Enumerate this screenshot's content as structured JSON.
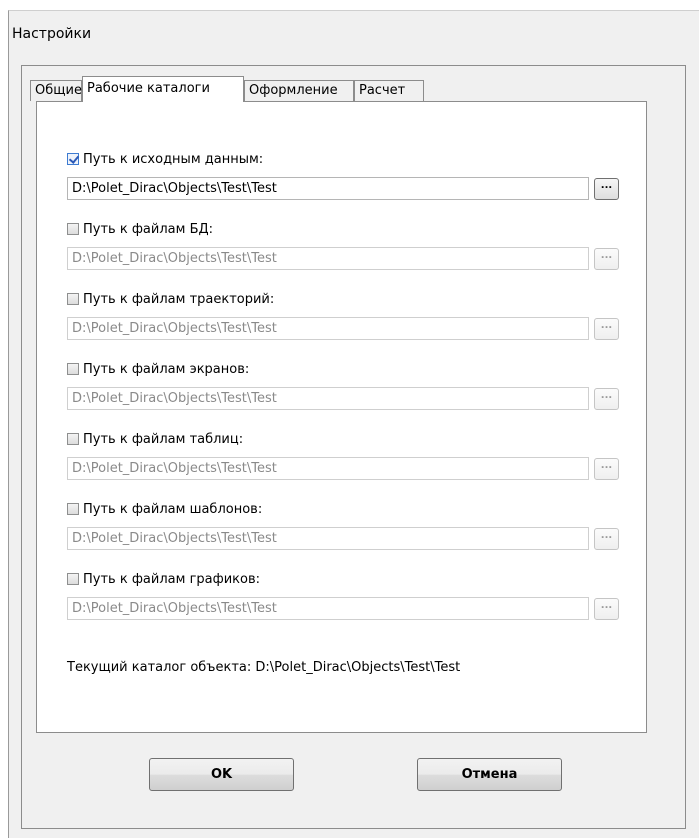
{
  "window": {
    "title": "Настройки"
  },
  "tabs": [
    {
      "label": "Общие",
      "active": false
    },
    {
      "label": "Рабочие каталоги",
      "active": true
    },
    {
      "label": "Оформление",
      "active": false
    },
    {
      "label": "Расчет",
      "active": false
    }
  ],
  "paths": [
    {
      "label": "Путь к исходным данным:",
      "checked": true,
      "value": "D:\\Polet_Dirac\\Objects\\Test\\Test",
      "enabled": true,
      "browse_label": "..."
    },
    {
      "label": "Путь к файлам БД:",
      "checked": false,
      "value": "D:\\Polet_Dirac\\Objects\\Test\\Test",
      "enabled": false,
      "browse_label": "..."
    },
    {
      "label": "Путь к файлам траекторий:",
      "checked": false,
      "value": "D:\\Polet_Dirac\\Objects\\Test\\Test",
      "enabled": false,
      "browse_label": "..."
    },
    {
      "label": "Путь к файлам экранов:",
      "checked": false,
      "value": "D:\\Polet_Dirac\\Objects\\Test\\Test",
      "enabled": false,
      "browse_label": "..."
    },
    {
      "label": "Путь к файлам таблиц:",
      "checked": false,
      "value": "D:\\Polet_Dirac\\Objects\\Test\\Test",
      "enabled": false,
      "browse_label": "..."
    },
    {
      "label": "Путь к файлам шаблонов:",
      "checked": false,
      "value": "D:\\Polet_Dirac\\Objects\\Test\\Test",
      "enabled": false,
      "browse_label": "..."
    },
    {
      "label": "Путь к файлам графиков:",
      "checked": false,
      "value": "D:\\Polet_Dirac\\Objects\\Test\\Test",
      "enabled": false,
      "browse_label": "..."
    }
  ],
  "current_dir": "Текущий каталог объекта: D:\\Polet_Dirac\\Objects\\Test\\Test",
  "buttons": {
    "ok": "OK",
    "cancel": "Отмена"
  }
}
